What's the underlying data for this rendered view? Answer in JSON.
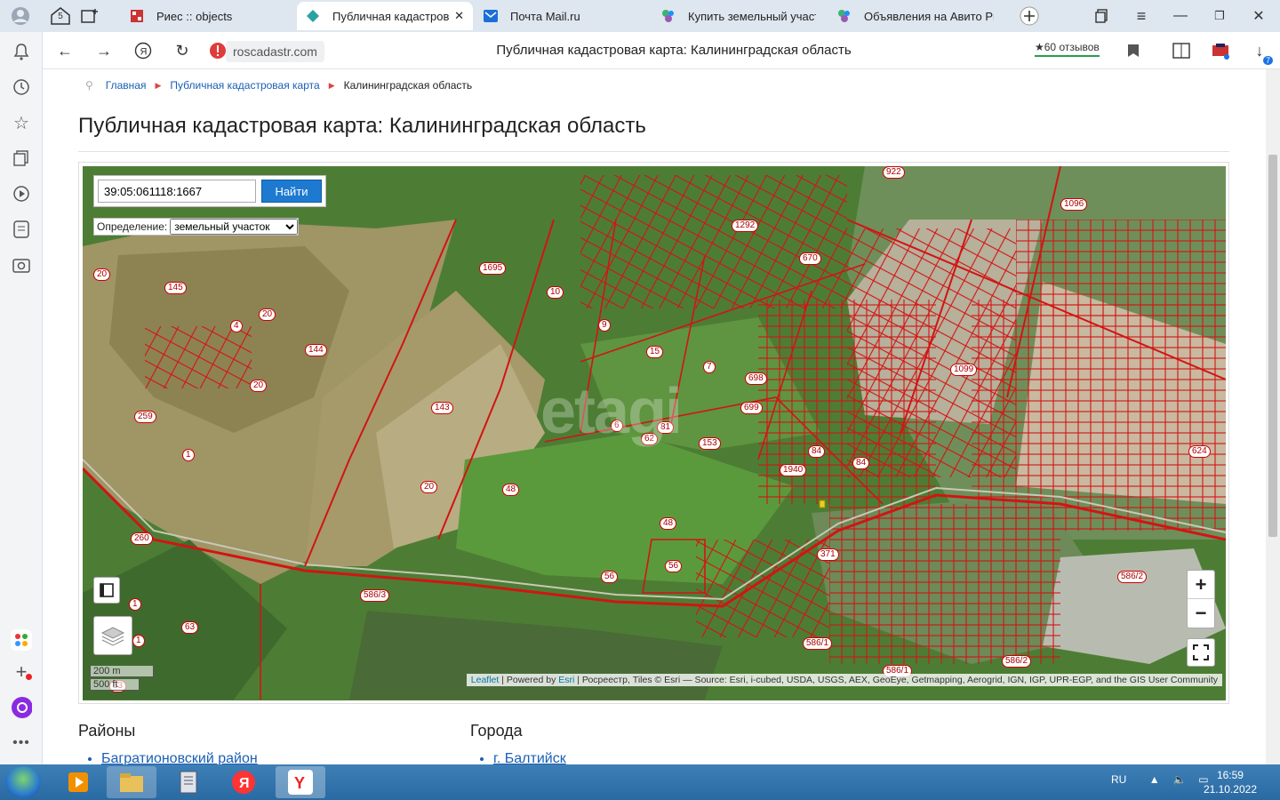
{
  "browser": {
    "tabs": [
      {
        "title": "Риес :: objects",
        "active": false
      },
      {
        "title": "Публичная кадастрова",
        "active": true
      },
      {
        "title": "Почта Mail.ru",
        "active": false
      },
      {
        "title": "Купить земельный участо",
        "active": false
      },
      {
        "title": "Объявления на Авито Pro",
        "active": false
      }
    ],
    "tab_counter": "5",
    "url": "roscadastr.com",
    "page_title": "Публичная кадастровая карта: Калининградская область",
    "reviews": "★60 отзывов",
    "downloads_badge": "7",
    "colors": {
      "tabbar": "#dee6ef",
      "accent": "#1d7ad0",
      "parcel_line": "#d21414"
    }
  },
  "breadcrumb": {
    "items": [
      "Главная",
      "Публичная кадастровая карта",
      "Калининградская область"
    ]
  },
  "heading": "Публичная кадастровая карта: Калининградская область",
  "map": {
    "search_value": "39:05:061118:1667",
    "search_button": "Найти",
    "definition_label": "Определение:",
    "definition_selected": "земельный участок",
    "zoom_in": "+",
    "zoom_out": "−",
    "scale_m": "200 m",
    "scale_ft": "500 ft",
    "watermark": "etagi",
    "attribution": {
      "leaflet": "Leaflet",
      "powered": "| Powered by",
      "esri": "Esri",
      "rest": "| Росреестр, Tiles © Esri — Source: Esri, i-cubed, USDA, USGS, AEX, GeoEye, Getmapping, Aerogrid, IGN, IGP, UPR-EGP, and the GIS User Community"
    },
    "parcel_labels": [
      "20",
      "145",
      "4",
      "20",
      "144",
      "20",
      "259",
      "1",
      "143",
      "1695",
      "10",
      "9",
      "15",
      "7",
      "698",
      "699",
      "6",
      "81",
      "62",
      "153",
      "20",
      "48",
      "48",
      "56",
      "56",
      "260",
      "1",
      "1",
      "63",
      "586/3",
      "1292",
      "670",
      "922",
      "1096",
      "1099",
      "84",
      "84",
      "1940",
      "624",
      "371",
      "586/2",
      "586/1",
      "586/1",
      "586/2",
      "63"
    ]
  },
  "sections": {
    "districts_title": "Районы",
    "districts_first": "Багратионовский район",
    "cities_title": "Города",
    "cities_first": "г. Балтийск"
  },
  "taskbar": {
    "lang": "RU",
    "time": "16:59",
    "date": "21.10.2022"
  }
}
